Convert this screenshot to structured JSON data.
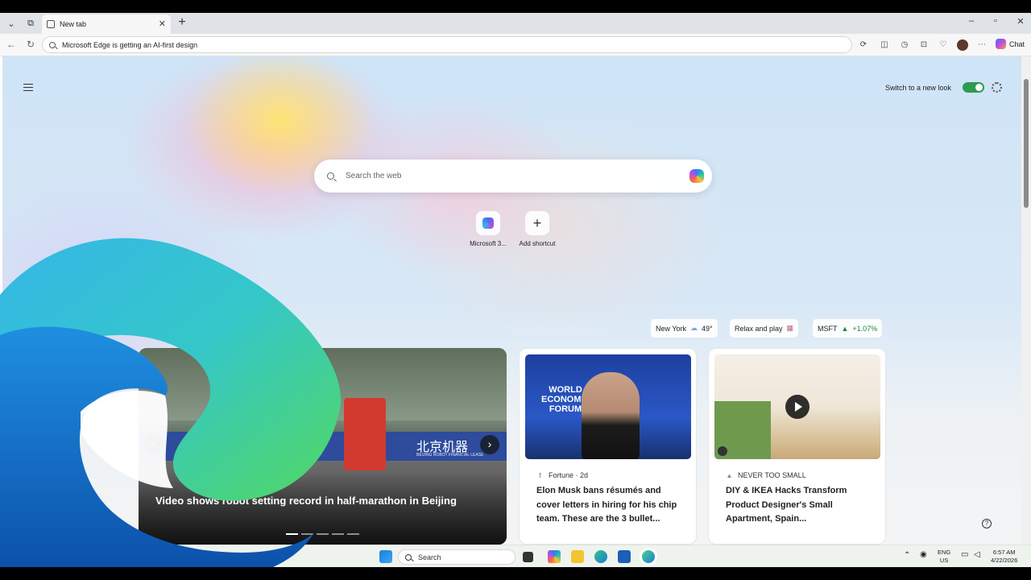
{
  "browser": {
    "tab_title": "New tab",
    "address": "Microsoft Edge is getting an AI-first design",
    "chat_label": "Chat"
  },
  "ntp": {
    "new_look_label": "Switch to a new look",
    "search_placeholder": "Search the web",
    "shortcuts": [
      {
        "label": "Microsoft 3...",
        "icon": "m365-icon"
      },
      {
        "label": "Add shortcut",
        "icon": "plus-icon"
      }
    ],
    "weather": {
      "city": "New York",
      "temp": "49°"
    },
    "play_label": "Relax and play",
    "stock": {
      "ticker": "MSFT",
      "change": "+1.07%"
    },
    "hero": {
      "title": "Video shows robot setting record in half-marathon in Beijing",
      "banner_text": "北京机器",
      "banner_sub": "BEIJING ROBOT FINANCIAL LEASE"
    },
    "cards": [
      {
        "source": "Fortune · 2d",
        "title": "Elon Musk bans résumés and cover letters in hiring for his chip team. These are the 3 bullet..."
      },
      {
        "source": "NEVER TOO SMALL",
        "title": "DIY & IKEA Hacks Transform Product Designer's Small Apartment, Spain..."
      }
    ],
    "wef_text": "WORLD ECONOMIC FORUM"
  },
  "taskbar": {
    "search_label": "Search",
    "lang": "ENG",
    "region": "US",
    "time": "6:57 AM",
    "date": "4/22/2026"
  }
}
